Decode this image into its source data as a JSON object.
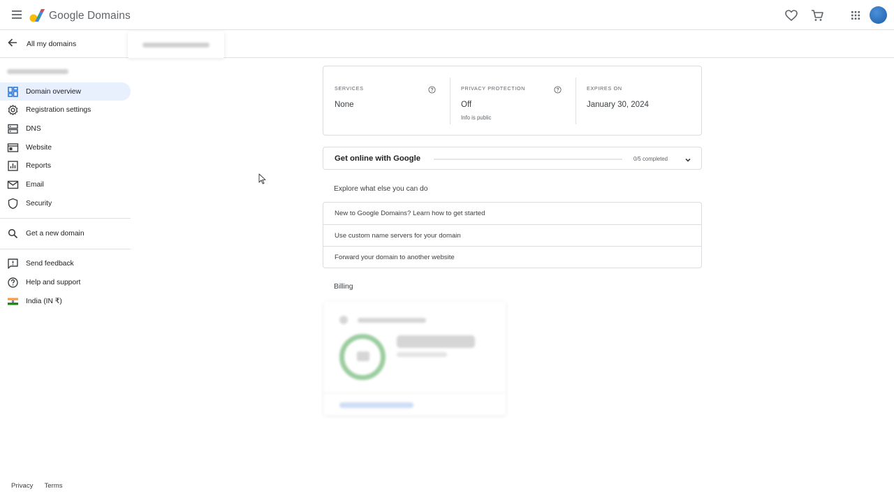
{
  "app": {
    "brand": "Google Domains"
  },
  "header": {
    "menu_icon": "hamburger-menu-icon",
    "favorites_icon": "heart-icon",
    "cart_icon": "shopping-cart-icon",
    "apps_icon": "apps-grid-icon"
  },
  "subheader": {
    "back_label": "All my domains"
  },
  "sidebar": {
    "items": [
      {
        "label": "Domain overview",
        "icon": "dashboard-icon",
        "active": true
      },
      {
        "label": "Registration settings",
        "icon": "gear-icon"
      },
      {
        "label": "DNS",
        "icon": "dns-icon"
      },
      {
        "label": "Website",
        "icon": "website-icon"
      },
      {
        "label": "Reports",
        "icon": "reports-icon"
      },
      {
        "label": "Email",
        "icon": "email-icon"
      },
      {
        "label": "Security",
        "icon": "shield-icon"
      }
    ],
    "get_domain": {
      "label": "Get a new domain",
      "icon": "search-icon"
    },
    "support": [
      {
        "label": "Send feedback",
        "icon": "feedback-icon"
      },
      {
        "label": "Help and support",
        "icon": "help-icon"
      },
      {
        "label": "India (IN ₹)",
        "icon": "india-flag-icon"
      }
    ]
  },
  "summary": {
    "services": {
      "caption": "SERVICES",
      "value": "None"
    },
    "privacy": {
      "caption": "PRIVACY PROTECTION",
      "value": "Off",
      "sub": "Info is public"
    },
    "expires": {
      "caption": "EXPIRES ON",
      "value": "January 30, 2024"
    }
  },
  "get_online": {
    "title": "Get online with Google",
    "progress_text": "0/5 completed",
    "progress_fraction": 0
  },
  "explore": {
    "heading": "Explore what else you can do",
    "items": [
      "New to Google Domains? Learn how to get started",
      "Use custom name servers for your domain",
      "Forward your domain to another website"
    ]
  },
  "billing": {
    "heading": "Billing"
  },
  "footer": {
    "privacy": "Privacy",
    "terms": "Terms"
  },
  "colors": {
    "active_bg": "#e8f0fe",
    "accent_blue": "#1a73e8",
    "border": "#dadce0"
  }
}
